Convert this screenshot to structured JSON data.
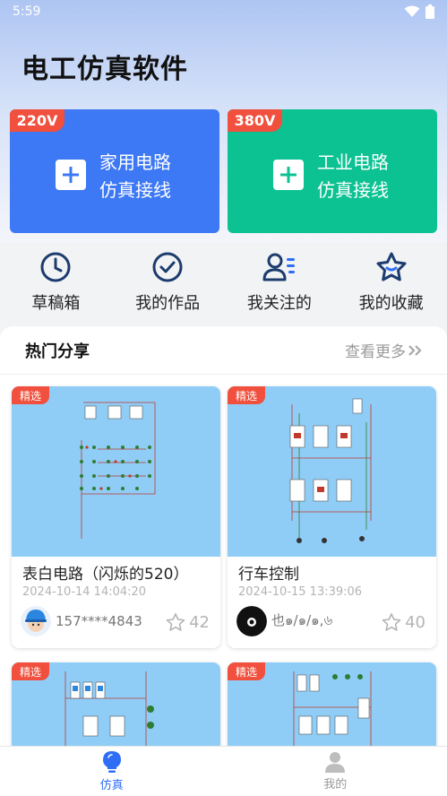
{
  "status_bar": {
    "time": "5:59"
  },
  "app_title": "电工仿真软件",
  "cards": [
    {
      "tag": "220V",
      "line1": "家用电路",
      "line2": "仿真接线",
      "color": "#3d78f5"
    },
    {
      "tag": "380V",
      "line1": "工业电路",
      "line2": "仿真接线",
      "color": "#0cc293"
    }
  ],
  "quick_nav": [
    {
      "label": "草稿箱",
      "icon": "clock-icon"
    },
    {
      "label": "我的作品",
      "icon": "check-circle-icon"
    },
    {
      "label": "我关注的",
      "icon": "user-follow-icon"
    },
    {
      "label": "我的收藏",
      "icon": "star-icon"
    }
  ],
  "hot_share": {
    "title": "热门分享",
    "see_more": "查看更多"
  },
  "posts": [
    {
      "badge": "精选",
      "title": "表白电路（闪烁的520）",
      "date": "2024-10-14 14:04:20",
      "author": "157****4843",
      "likes": "42"
    },
    {
      "badge": "精选",
      "title": "行车控制",
      "date": "2024-10-15 13:39:06",
      "author": "也๑/๑/๑,৬",
      "likes": "40"
    },
    {
      "badge": "精选"
    },
    {
      "badge": "精选"
    }
  ],
  "tabbar": [
    {
      "label": "仿真",
      "active": true
    },
    {
      "label": "我的",
      "active": false
    }
  ],
  "colors": {
    "accent": "#2f6ef4",
    "badge": "#f0503d",
    "thumb_bg": "#8fcdf7"
  }
}
